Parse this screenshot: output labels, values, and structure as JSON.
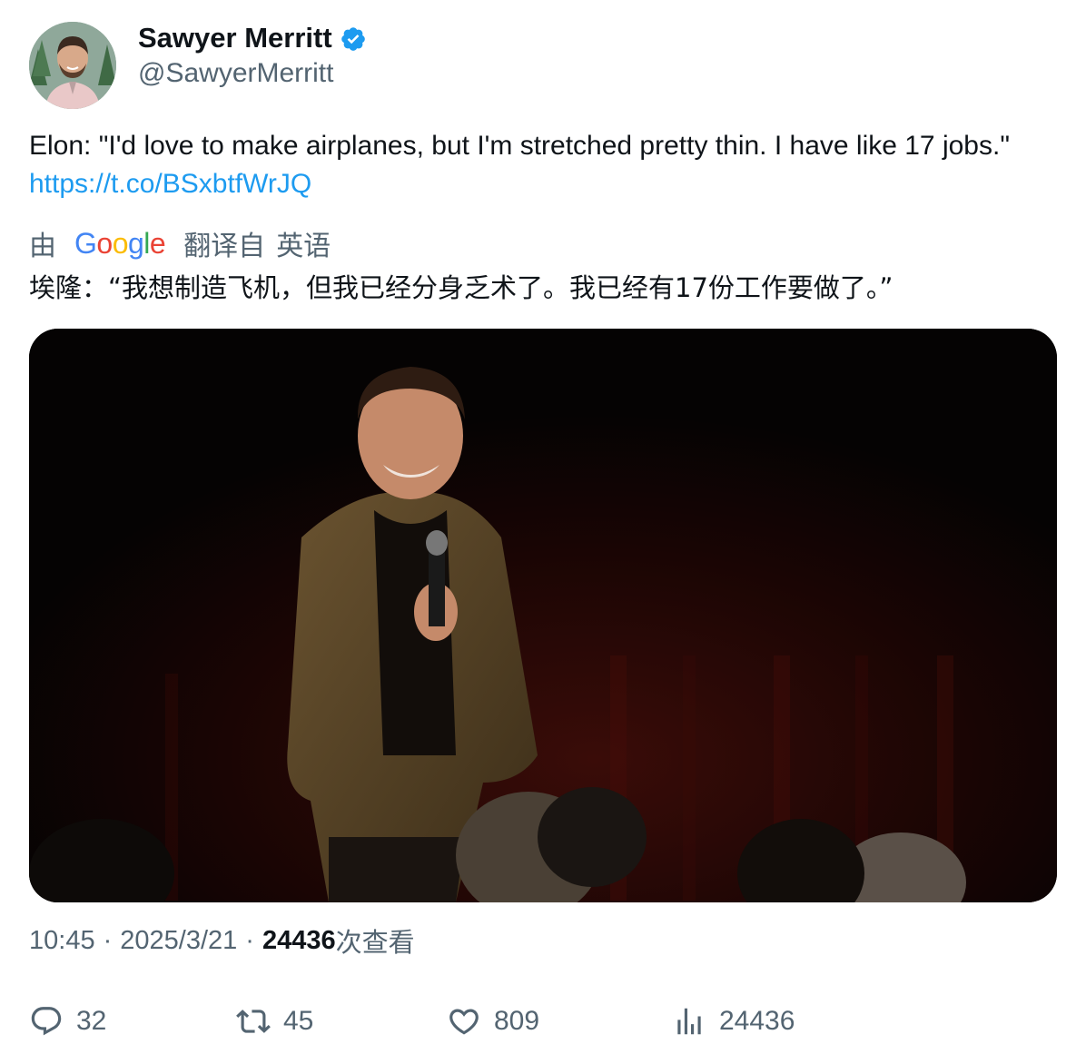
{
  "author": {
    "display_name": "Sawyer Merritt",
    "handle": "@SawyerMerritt",
    "verified": true
  },
  "tweet": {
    "text": "Elon: \"I'd love to make airplanes, but I'm stretched pretty thin. I have like 17 jobs.\" ",
    "link": "https://t.co/BSxbtfWrJQ"
  },
  "translation": {
    "by_label": "由",
    "provider": "Google",
    "translated_from_label": "翻译自",
    "source_language": "英语",
    "text": "埃隆：“我想制造飞机，但我已经分身乏术了。我已经有17份工作要做了。”"
  },
  "meta": {
    "time": "10:45",
    "separator": "·",
    "date": "2025/3/21",
    "views_count": "24436",
    "views_label": "次查看"
  },
  "actions": {
    "replies": "32",
    "retweets": "45",
    "likes": "809",
    "views": "24436"
  },
  "colors": {
    "link": "#1d9bf0",
    "verified": "#1d9bf0",
    "secondary_text": "#536471",
    "primary_text": "#0f1419"
  },
  "icons": [
    "verified-badge-icon",
    "reply-icon",
    "retweet-icon",
    "like-icon",
    "views-icon"
  ]
}
